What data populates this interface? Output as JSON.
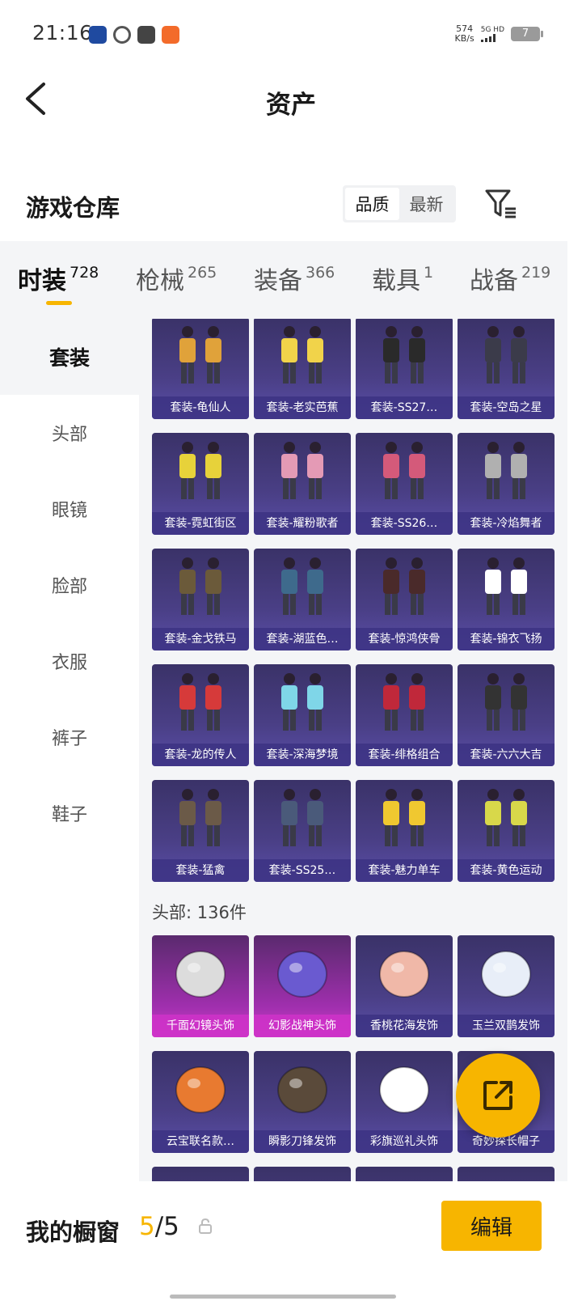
{
  "status_bar": {
    "time": "21:16",
    "net_speed_value": "574",
    "net_speed_unit": "KB/s",
    "network": "5G HD",
    "battery": "7"
  },
  "nav": {
    "title": "资产"
  },
  "section": {
    "title": "游戏仓库",
    "sort_options": [
      "品质",
      "最新"
    ],
    "sort_selected": "品质"
  },
  "tabs": [
    {
      "label": "时装",
      "count": "728"
    },
    {
      "label": "枪械",
      "count": "265"
    },
    {
      "label": "装备",
      "count": "366"
    },
    {
      "label": "载具",
      "count": "1"
    },
    {
      "label": "战备",
      "count": "219"
    }
  ],
  "sidebar": [
    "套装",
    "头部",
    "眼镜",
    "脸部",
    "衣服",
    "裤子",
    "鞋子"
  ],
  "suits": [
    {
      "name": "套装-龟仙人"
    },
    {
      "name": "套装-老实芭蕉"
    },
    {
      "name": "套装-SS27…"
    },
    {
      "name": "套装-空岛之星"
    },
    {
      "name": "套装-霓虹街区"
    },
    {
      "name": "套装-耀粉歌者"
    },
    {
      "name": "套装-SS26…"
    },
    {
      "name": "套装-冷焰舞者"
    },
    {
      "name": "套装-金戈铁马"
    },
    {
      "name": "套装-湖蓝色…"
    },
    {
      "name": "套装-惊鸿侠骨"
    },
    {
      "name": "套装-锦衣飞扬"
    },
    {
      "name": "套装-龙的传人"
    },
    {
      "name": "套装-深海梦境"
    },
    {
      "name": "套装-绯格组合"
    },
    {
      "name": "套装-六六大吉"
    },
    {
      "name": "套装-猛禽"
    },
    {
      "name": "套装-SS25…"
    },
    {
      "name": "套装-魅力单车"
    },
    {
      "name": "套装-黄色运动"
    }
  ],
  "head_group_label": "头部: 136件",
  "head_items": [
    {
      "name": "千面幻镜头饰",
      "rarity": "pink"
    },
    {
      "name": "幻影战神头饰",
      "rarity": "pink"
    },
    {
      "name": "香桃花海发饰",
      "rarity": "purple"
    },
    {
      "name": "玉兰双鹊发饰",
      "rarity": "purple"
    },
    {
      "name": "云宝联名款…",
      "rarity": "purple"
    },
    {
      "name": "瞬影刀锋发饰",
      "rarity": "purple"
    },
    {
      "name": "彩旗巡礼头饰",
      "rarity": "purple"
    },
    {
      "name": "奇妙探长帽子",
      "rarity": "purple"
    }
  ],
  "bottom": {
    "label": "我的橱窗",
    "current": "5",
    "total": "/5",
    "edit_label": "编辑"
  },
  "colors": {
    "accent": "#f7b500",
    "card_purple": "#4a3f86",
    "card_pink": "#c43cc0"
  },
  "icons": [
    "back-arrow-icon",
    "filter-icon",
    "lock-icon",
    "share-external-icon"
  ]
}
